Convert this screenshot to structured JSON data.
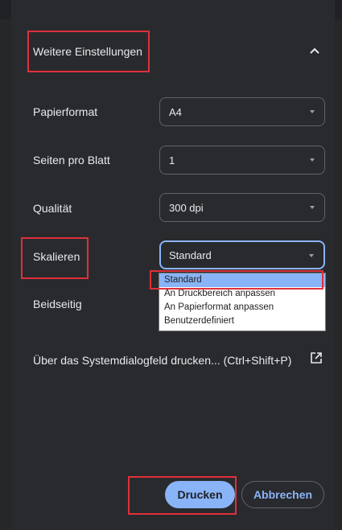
{
  "section": {
    "title": "Weitere Einstellungen",
    "collapse_icon": "chevron-up-icon"
  },
  "settings": [
    {
      "label": "Papierformat",
      "value": "A4"
    },
    {
      "label": "Seiten pro Blatt",
      "value": "1"
    },
    {
      "label": "Qualität",
      "value": "300 dpi"
    },
    {
      "label": "Skalieren",
      "value": "Standard"
    },
    {
      "label": "Beidseitig"
    }
  ],
  "scale_dropdown": {
    "options": [
      "Standard",
      "An Druckbereich anpassen",
      "An Papierformat anpassen",
      "Benutzerdefiniert"
    ],
    "selected": "Standard"
  },
  "system_dialog": {
    "label": "Über das Systemdialogfeld drucken... (Ctrl+Shift+P)",
    "icon": "open-in-new-icon"
  },
  "buttons": {
    "print": "Drucken",
    "cancel": "Abbrechen"
  },
  "colors": {
    "accent": "#8ab4f8",
    "background": "#292a2d",
    "highlight_box": "#e0303a"
  }
}
